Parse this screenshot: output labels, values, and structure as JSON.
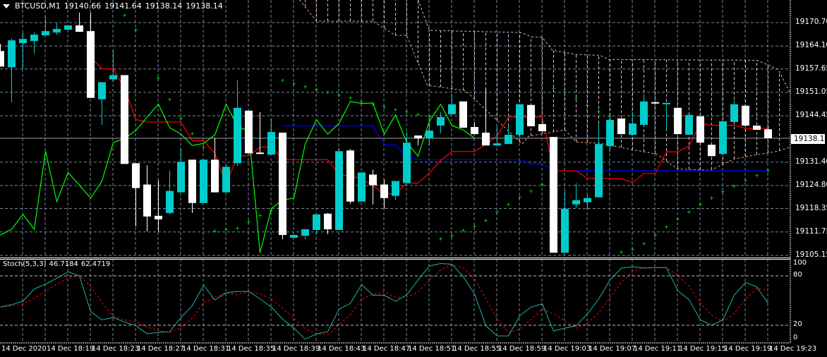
{
  "header": {
    "symbol": "BTCUSD,M1",
    "open": "19140.66",
    "high": "19141.64",
    "low": "19138.14",
    "close": "19138.14"
  },
  "price_axis": {
    "labels": [
      "19170.70",
      "19164.10",
      "19157.65",
      "19151.05",
      "19144.45",
      "19131.40",
      "19124.80",
      "19118.35",
      "19111.75",
      "19105.15"
    ],
    "current": "19138.14"
  },
  "stoch": {
    "title": "Stoch(5,3,3)",
    "main": "46.7184",
    "signal": "62.4719",
    "levels": [
      "100",
      "80",
      "20",
      "0"
    ]
  },
  "time_axis": [
    "14 Dec 2020",
    "14 Dec 18:19",
    "14 Dec 18:23",
    "14 Dec 18:27",
    "14 Dec 18:31",
    "14 Dec 18:35",
    "14 Dec 18:39",
    "14 Dec 18:43",
    "14 Dec 18:47",
    "14 Dec 18:51",
    "14 Dec 18:55",
    "14 Dec 18:59",
    "14 Dec 19:03",
    "14 Dec 19:07",
    "14 Dec 19:11",
    "14 Dec 19:15",
    "14 Dec 19:19",
    "14 Dec 19:23"
  ],
  "colors": {
    "bull": "#00cccc",
    "bear": "#ffffff",
    "tenkan": "#ff0000",
    "kijun": "#0000ff",
    "chikou": "#00ff00",
    "senkou_a": "#f4a460",
    "senkou_b": "#d8bfd8",
    "sar": "#00ff00",
    "stoch_main": "#20b2aa",
    "stoch_signal": "#ff0000",
    "grid": "#778899"
  },
  "chart_data": {
    "type": "candlestick",
    "symbol": "BTCUSD",
    "timeframe": "M1",
    "ylim": [
      19105.15,
      19170.7
    ],
    "ohlc": [
      [
        19162.7,
        19164.7,
        19158.3,
        19158.3
      ],
      [
        19158.1,
        19166.3,
        19148.3,
        19165.7
      ],
      [
        19164.9,
        19167.9,
        19157.7,
        19166.1
      ],
      [
        19165.5,
        19167.9,
        19161.9,
        19167.3
      ],
      [
        19167.1,
        19172.5,
        19167.1,
        19168.3
      ],
      [
        19167.9,
        19170.7,
        19167.3,
        19168.9
      ],
      [
        19168.7,
        19169.9,
        19168.7,
        19169.9
      ],
      [
        19169.9,
        19173.5,
        19168.1,
        19168.1
      ],
      [
        19168.3,
        19173.5,
        19149.5,
        19149.5
      ],
      [
        19149.1,
        19153.9,
        19141.9,
        19153.9
      ],
      [
        19154.7,
        19162.9,
        19153.9,
        19155.9
      ],
      [
        19155.9,
        19155.9,
        19130.9,
        19130.9
      ],
      [
        19131.1,
        19131.1,
        19113.3,
        19124.1
      ],
      [
        19125.1,
        19130.5,
        19111.9,
        19116.1
      ],
      [
        19116.3,
        19126.3,
        19111.9,
        19115.3
      ],
      [
        19117.1,
        19129.1,
        19116.7,
        19123.3
      ],
      [
        19122.9,
        19135.3,
        19122.9,
        19131.5
      ],
      [
        19132.1,
        19132.1,
        19117.1,
        19119.9
      ],
      [
        19119.9,
        19132.1,
        19119.9,
        19132.1
      ],
      [
        19132.1,
        19138.3,
        19122.9,
        19122.9
      ],
      [
        19122.9,
        19130.7,
        19122.9,
        19130.1
      ],
      [
        19131.1,
        19154.5,
        19130.3,
        19146.7
      ],
      [
        19145.9,
        19145.9,
        19133.9,
        19133.9
      ],
      [
        19134.1,
        19145.5,
        19133.7,
        19133.7
      ],
      [
        19133.5,
        19143.7,
        19133.5,
        19139.9
      ],
      [
        19139.7,
        19139.7,
        19109.7,
        19110.9
      ],
      [
        19110.1,
        19110.9,
        19110.1,
        19110.9
      ],
      [
        19110.7,
        19112.5,
        19109.7,
        19112.5
      ],
      [
        19112.3,
        19116.7,
        19111.1,
        19116.7
      ],
      [
        19116.9,
        19117.1,
        19111.1,
        19112.5
      ],
      [
        19112.3,
        19135.3,
        19112.3,
        19134.5
      ],
      [
        19134.7,
        19135.1,
        19119.7,
        19120.3
      ],
      [
        19120.3,
        19128.5,
        19120.3,
        19128.5
      ],
      [
        19127.9,
        19129.3,
        19119.5,
        19124.9
      ],
      [
        19125.1,
        19126.5,
        19118.3,
        19121.3
      ],
      [
        19121.9,
        19126.1,
        19120.7,
        19126.1
      ],
      [
        19125.5,
        19139.9,
        19125.5,
        19136.9
      ],
      [
        19138.9,
        19138.9,
        19136.1,
        19138.1
      ],
      [
        19138.1,
        19144.3,
        19136.1,
        19140.3
      ],
      [
        19141.7,
        19145.5,
        19139.5,
        19144.1
      ],
      [
        19144.9,
        19150.5,
        19144.9,
        19147.7
      ],
      [
        19148.5,
        19148.5,
        19141.1,
        19141.1
      ],
      [
        19141.3,
        19142.7,
        19139.3,
        19139.3
      ],
      [
        19139.7,
        19152.1,
        19136.1,
        19136.1
      ],
      [
        19136.1,
        19141.7,
        19136.1,
        19136.7
      ],
      [
        19136.5,
        19141.7,
        19136.5,
        19139.1
      ],
      [
        19139.1,
        19147.7,
        19139.1,
        19147.7
      ],
      [
        19147.5,
        19147.5,
        19141.5,
        19141.5
      ],
      [
        19142.1,
        19142.1,
        19140.1,
        19140.1
      ],
      [
        19138.5,
        19138.5,
        19105.9,
        19105.9
      ],
      [
        19105.9,
        19123.5,
        19105.9,
        19118.3
      ],
      [
        19119.5,
        19125.5,
        19118.5,
        19120.7
      ],
      [
        19120.1,
        19122.1,
        19118.1,
        19121.3
      ],
      [
        19121.5,
        19142.3,
        19121.5,
        19136.5
      ],
      [
        19135.9,
        19143.3,
        19134.3,
        19143.3
      ],
      [
        19143.7,
        19143.7,
        19139.3,
        19139.3
      ],
      [
        19139.1,
        19145.5,
        19139.1,
        19142.3
      ],
      [
        19141.9,
        19150.5,
        19141.9,
        19148.5
      ],
      [
        19148.3,
        19148.3,
        19147.9,
        19147.9
      ],
      [
        19147.7,
        19148.1,
        19140.3,
        19148.1
      ],
      [
        19146.7,
        19146.7,
        19139.3,
        19139.3
      ],
      [
        19139.1,
        19144.7,
        19139.1,
        19144.7
      ],
      [
        19144.3,
        19144.3,
        19136.9,
        19136.9
      ],
      [
        19136.3,
        19136.3,
        19133.1,
        19133.1
      ],
      [
        19133.7,
        19142.9,
        19133.7,
        19142.9
      ],
      [
        19142.7,
        19148.7,
        19142.7,
        19147.7
      ],
      [
        19147.3,
        19147.3,
        19141.7,
        19141.7
      ],
      [
        19141.7,
        19141.7,
        19140.5,
        19140.5
      ],
      [
        19140.66,
        19141.64,
        19138.14,
        19138.14
      ]
    ],
    "sar": [
      [
        11,
        19172.9
      ],
      [
        12,
        19168.7
      ],
      [
        14,
        19155.1
      ],
      [
        15,
        19149.1
      ],
      [
        16,
        19143.9
      ],
      [
        17,
        19139.5
      ],
      [
        18,
        19135.7
      ],
      [
        19,
        19112.1
      ],
      [
        20,
        19112.5
      ],
      [
        21,
        19112.9
      ],
      [
        22,
        19114.7
      ],
      [
        23,
        19116.5
      ],
      [
        24,
        19117.9
      ],
      [
        25,
        19154.5
      ],
      [
        26,
        19153.5
      ],
      [
        27,
        19152.7
      ],
      [
        28,
        19151.9
      ],
      [
        29,
        19151.1
      ],
      [
        30,
        19150.3
      ],
      [
        31,
        19149.5
      ],
      [
        32,
        19148.5
      ],
      [
        33,
        19147.9
      ],
      [
        34,
        19147.1
      ],
      [
        35,
        19146.3
      ],
      [
        36,
        19145.7
      ],
      [
        37,
        19144.9
      ],
      [
        38,
        19144.3
      ],
      [
        39,
        19109.9
      ],
      [
        40,
        19110.7
      ],
      [
        41,
        19112.3
      ],
      [
        42,
        19113.5
      ],
      [
        43,
        19115.1
      ],
      [
        44,
        19117.5
      ],
      [
        45,
        19119.5
      ],
      [
        46,
        19121.5
      ],
      [
        47,
        19123.3
      ],
      [
        48,
        19125.1
      ],
      [
        49,
        19152.1
      ],
      [
        50,
        19151.1
      ],
      [
        51,
        19149.3
      ],
      [
        52,
        19147.5
      ],
      [
        53,
        19145.9
      ],
      [
        54,
        19144.3
      ],
      [
        55,
        19106.1
      ],
      [
        56,
        19106.9
      ],
      [
        57,
        19108.5
      ],
      [
        58,
        19110.9
      ],
      [
        59,
        19113.3
      ],
      [
        60,
        19115.5
      ],
      [
        61,
        19117.5
      ],
      [
        62,
        19119.5
      ],
      [
        63,
        19121.3
      ],
      [
        64,
        19123.1
      ],
      [
        65,
        19124.7
      ],
      [
        66,
        19126.3
      ],
      [
        67,
        19127.7
      ],
      [
        68,
        19129.1
      ]
    ],
    "senkou_a": [
      [
        26.5,
        19177.1
      ],
      [
        28,
        19171.1
      ],
      [
        33,
        19171.1
      ],
      [
        35,
        19167.1
      ],
      [
        36,
        19167.1
      ],
      [
        37.8,
        19153.1
      ],
      [
        41.2,
        19151.5
      ],
      [
        43.7,
        19144.1
      ],
      [
        46.2,
        19136.5
      ],
      [
        46.8,
        19138.7
      ],
      [
        50,
        19140.5
      ],
      [
        51,
        19137.1
      ],
      [
        53.1,
        19136.7
      ],
      [
        56,
        19134.9
      ],
      [
        58.1,
        19133.7
      ],
      [
        60,
        19129.5
      ],
      [
        62.9,
        19129.1
      ],
      [
        65,
        19132.3
      ],
      [
        67,
        19133.5
      ],
      [
        68.9,
        19134.5
      ],
      [
        70,
        19135.7
      ]
    ],
    "senkou_b": [
      [
        37,
        19177.1
      ],
      [
        38,
        19168.5
      ],
      [
        46.2,
        19167.9
      ],
      [
        47,
        19166.7
      ],
      [
        48,
        19166.5
      ],
      [
        48.9,
        19162.9
      ],
      [
        51,
        19161.7
      ],
      [
        53.1,
        19161.5
      ],
      [
        53.9,
        19160.3
      ],
      [
        67,
        19160.1
      ],
      [
        68.9,
        19157.5
      ],
      [
        70,
        19150.5
      ]
    ],
    "stoch_k": [
      42,
      45,
      49,
      64,
      70,
      77,
      85,
      80,
      36.5,
      26.5,
      29.4,
      24,
      19.4,
      9.5,
      11.4,
      12.2,
      29.4,
      43.7,
      68.6,
      50.8,
      59.4,
      61,
      61,
      52,
      42,
      27.4,
      16.5,
      3,
      9.5,
      12.2,
      39.4,
      46.5,
      69.3,
      56.5,
      56.5,
      49,
      57,
      75,
      92,
      95,
      94,
      79,
      58,
      19.4,
      7,
      7,
      31.4,
      42,
      46,
      13,
      16.5,
      19.4,
      33.7,
      52,
      75,
      89.4,
      91,
      89.4,
      90,
      90,
      62,
      51,
      26.5,
      20,
      26.5,
      56.5,
      72,
      66.5,
      46.7
    ],
    "stoch_ylim": [
      0,
      100
    ]
  }
}
